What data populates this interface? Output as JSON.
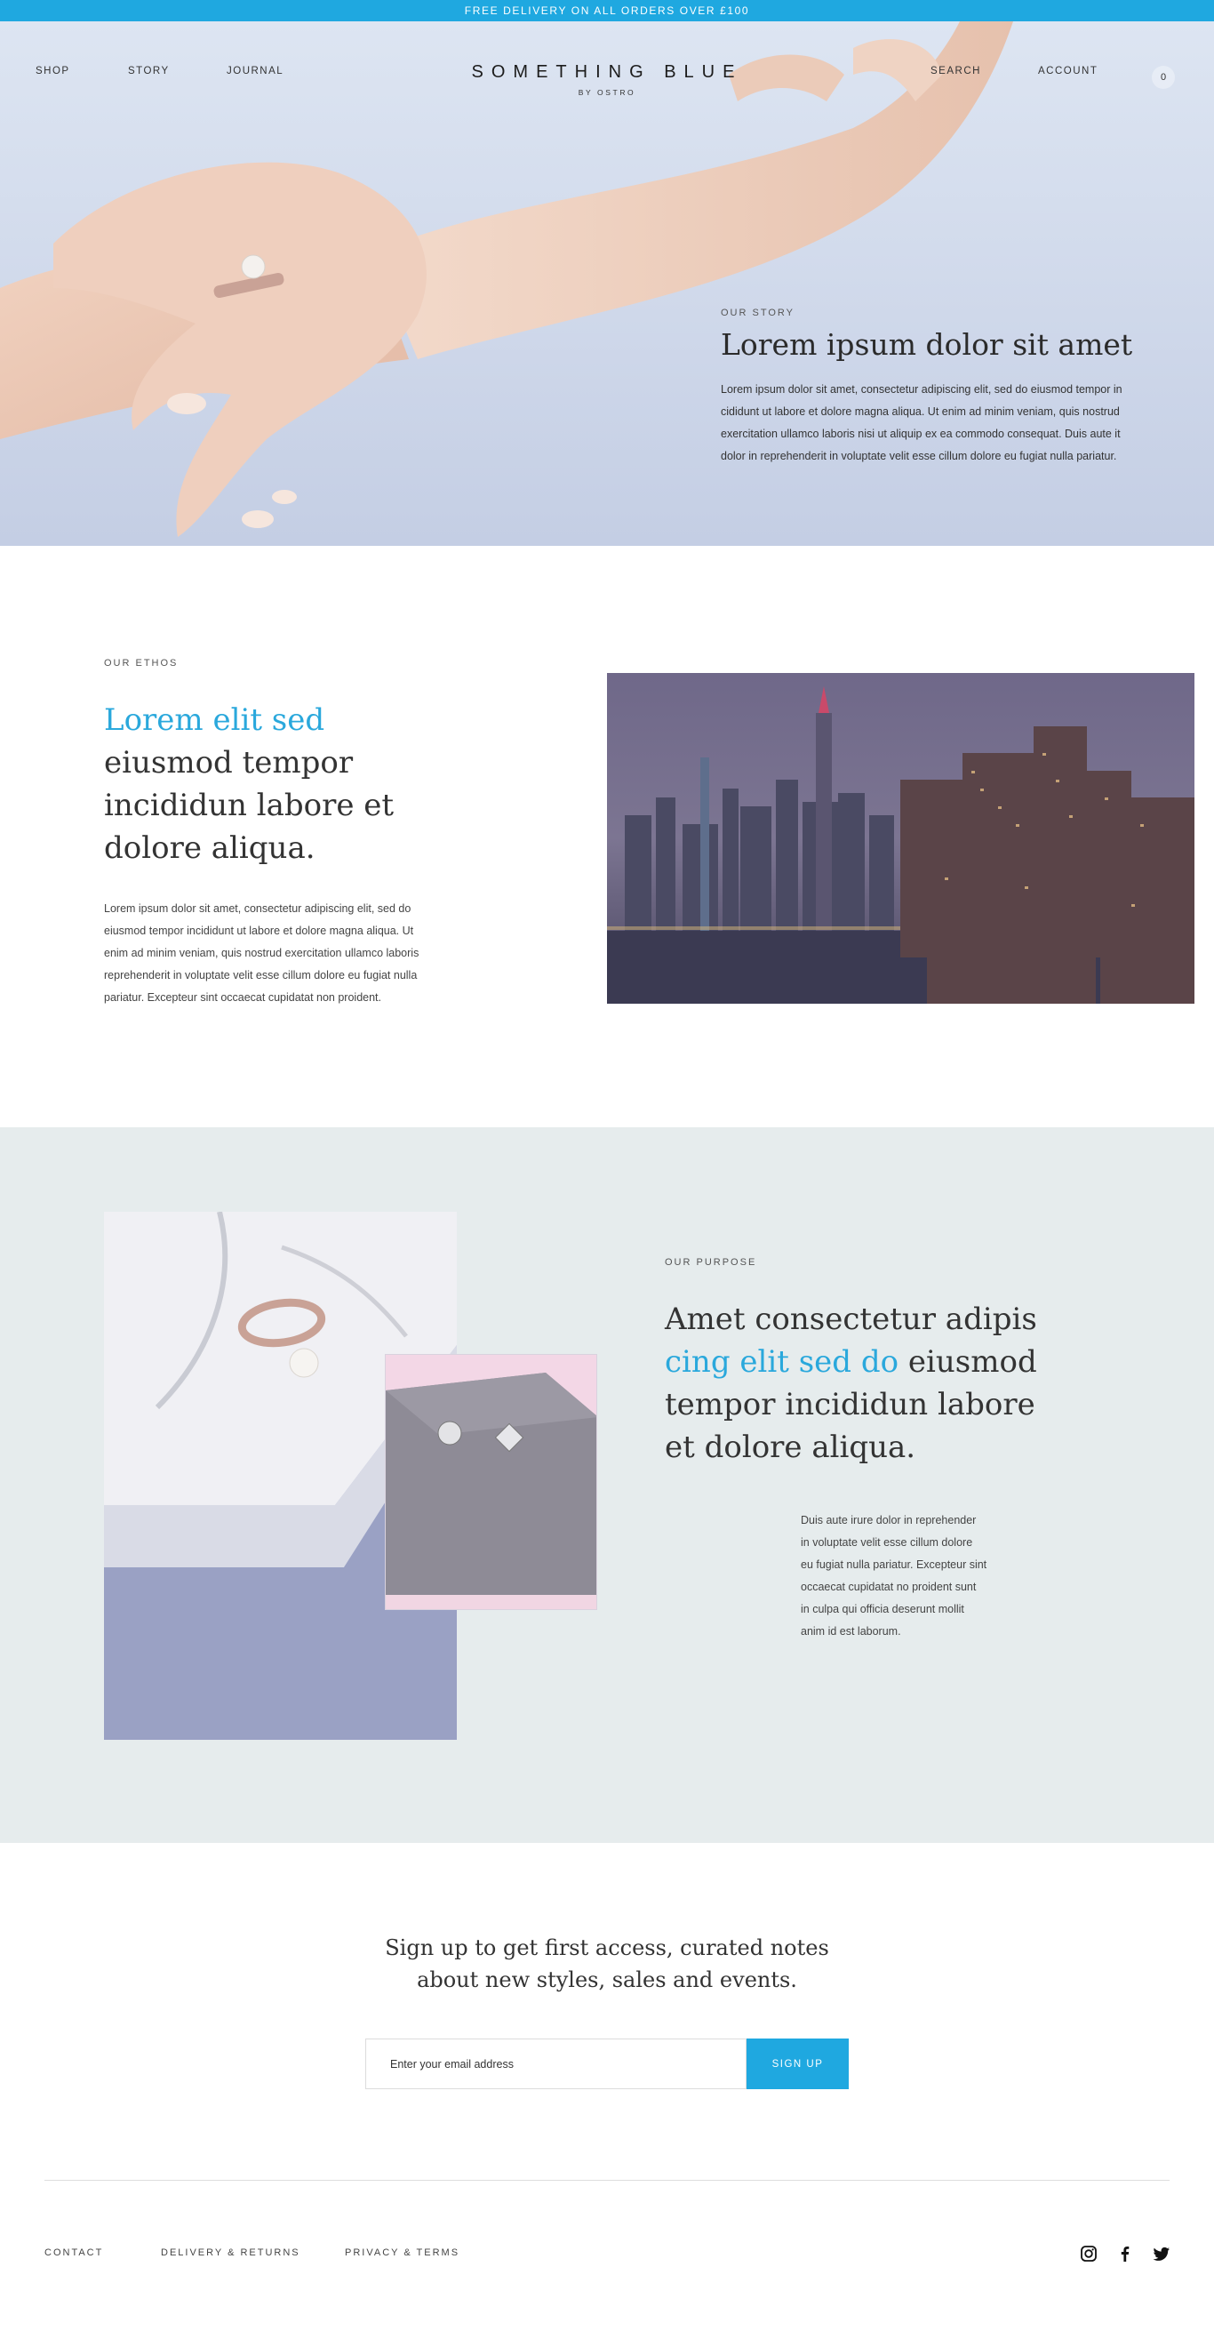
{
  "announcement": {
    "text": "FREE DELIVERY ON ALL ORDERS OVER £100"
  },
  "nav": {
    "shop": "SHOP",
    "story": "STORY",
    "journal": "JOURNAL",
    "search": "SEARCH",
    "account": "ACCOUNT",
    "cart_count": "0"
  },
  "brand": {
    "title": "SOMETHING BLUE",
    "subtitle": "BY OSTRO"
  },
  "hero": {
    "eyebrow": "OUR STORY",
    "title": "Lorem ipsum dolor sit amet",
    "body": "Lorem ipsum dolor sit amet, consectetur adipiscing elit, sed do eiusmod tempor in cididunt ut labore et dolore magna aliqua. Ut enim ad minim veniam, quis nostrud exercitation ullamco laboris nisi ut aliquip ex ea commodo consequat. Duis aute it dolor in reprehenderit in voluptate velit esse cillum dolore eu fugiat nulla pariatur."
  },
  "ethos": {
    "eyebrow": "OUR ETHOS",
    "heading_accent": "Lorem elit sed",
    "heading_rest": " eiusmod tempor incididun labore et dolore aliqua.",
    "body": "Lorem ipsum dolor sit amet, consectetur adipiscing elit, sed do eiusmod tempor incididunt ut labore et dolore magna aliqua. Ut enim ad minim veniam, quis nostrud exercitation ullamco laboris reprehenderit in voluptate velit esse cillum dolore eu fugiat nulla pariatur. Excepteur sint occaecat cupidatat non proident."
  },
  "purpose": {
    "eyebrow": "OUR PURPOSE",
    "heading_start": "Amet consectetur adipis ",
    "heading_accent": "cing elit sed do",
    "heading_rest": " eiusmod tempor incididun labore et dolore aliqua.",
    "body": "Duis aute irure dolor in reprehender in voluptate velit esse cillum dolore eu fugiat nulla pariatur. Excepteur sint occaecat cupidatat no proident sunt in culpa qui officia deserunt mollit anim id est laborum."
  },
  "signup": {
    "title_line1": "Sign up to get first access, curated notes",
    "title_line2": "about new styles, sales and events.",
    "email_placeholder": "Enter your email address",
    "button_label": "SIGN UP"
  },
  "footer": {
    "contact": "CONTACT",
    "delivery": "DELIVERY & RETURNS",
    "privacy": "PRIVACY & TERMS",
    "social_icons": [
      "instagram-icon",
      "facebook-icon",
      "twitter-icon"
    ]
  },
  "colors": {
    "accent": "#1fa8e0",
    "purpose_bg": "#e6eced"
  }
}
